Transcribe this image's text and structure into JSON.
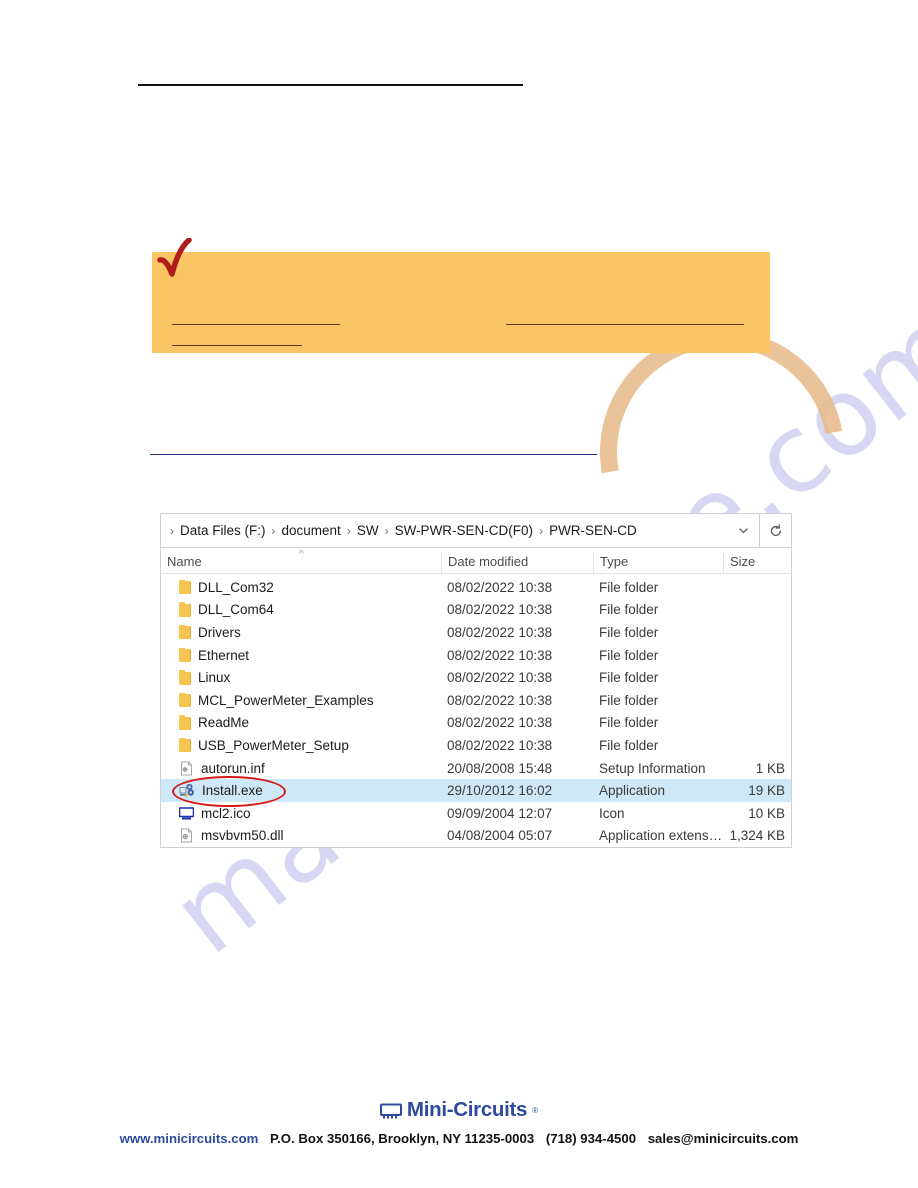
{
  "page": {
    "callout": {
      "background_color": "#fcc564",
      "checkmark_color": "#b01c1c",
      "redacted_lines": 3
    },
    "rules": {
      "top_rule_color": "#111111",
      "blue_rule_color": "#1f2a7a"
    }
  },
  "watermark": {
    "text": "manualshive.com",
    "color": "#c9c9ef"
  },
  "explorer": {
    "address_bar": {
      "breadcrumbs": [
        "Data Files (F:)",
        "document",
        "SW",
        "SW-PWR-SEN-CD(F0)",
        "PWR-SEN-CD"
      ],
      "separator": "›",
      "dropdown_icon": "chevron-down-icon",
      "refresh_icon": "refresh-icon"
    },
    "columns": [
      {
        "label": "Name",
        "sorted": "ascending",
        "sort_icon": "caret-up-icon"
      },
      {
        "label": "Date modified"
      },
      {
        "label": "Type"
      },
      {
        "label": "Size"
      }
    ],
    "selection_color": "#cfe8f7",
    "highlight_circle_color": "#d51a1a",
    "rows": [
      {
        "name": "DLL_Com32",
        "icon": "folder-icon",
        "date": "08/02/2022 10:38",
        "type": "File folder",
        "size": ""
      },
      {
        "name": "DLL_Com64",
        "icon": "folder-icon",
        "date": "08/02/2022 10:38",
        "type": "File folder",
        "size": ""
      },
      {
        "name": "Drivers",
        "icon": "folder-icon",
        "date": "08/02/2022 10:38",
        "type": "File folder",
        "size": ""
      },
      {
        "name": "Ethernet",
        "icon": "folder-icon",
        "date": "08/02/2022 10:38",
        "type": "File folder",
        "size": ""
      },
      {
        "name": "Linux",
        "icon": "folder-icon",
        "date": "08/02/2022 10:38",
        "type": "File folder",
        "size": ""
      },
      {
        "name": "MCL_PowerMeter_Examples",
        "icon": "folder-icon",
        "date": "08/02/2022 10:38",
        "type": "File folder",
        "size": ""
      },
      {
        "name": "ReadMe",
        "icon": "folder-icon",
        "date": "08/02/2022 10:38",
        "type": "File folder",
        "size": ""
      },
      {
        "name": "USB_PowerMeter_Setup",
        "icon": "folder-icon",
        "date": "08/02/2022 10:38",
        "type": "File folder",
        "size": ""
      },
      {
        "name": "autorun.inf",
        "icon": "setup-info-icon",
        "date": "20/08/2008 15:48",
        "type": "Setup Information",
        "size": "1 KB"
      },
      {
        "name": "Install.exe",
        "icon": "application-icon",
        "date": "29/10/2012 16:02",
        "type": "Application",
        "size": "19 KB",
        "selected": true,
        "circled": true
      },
      {
        "name": "mcl2.ico",
        "icon": "icon-file-icon",
        "date": "09/09/2004 12:07",
        "type": "Icon",
        "size": "10 KB"
      },
      {
        "name": "msvbvm50.dll",
        "icon": "dll-file-icon",
        "date": "04/08/2004 05:07",
        "type": "Application extens…",
        "size": "1,324 KB"
      }
    ]
  },
  "footer": {
    "logo_text": "Mini-Circuits",
    "logo_tm": "®",
    "logo_color": "#2e4a9e",
    "website": "www.minicircuits.com",
    "address": "P.O. Box 350166, Brooklyn, NY 11235-0003",
    "phone": "(718) 934-4500",
    "email": "sales@minicircuits.com"
  }
}
